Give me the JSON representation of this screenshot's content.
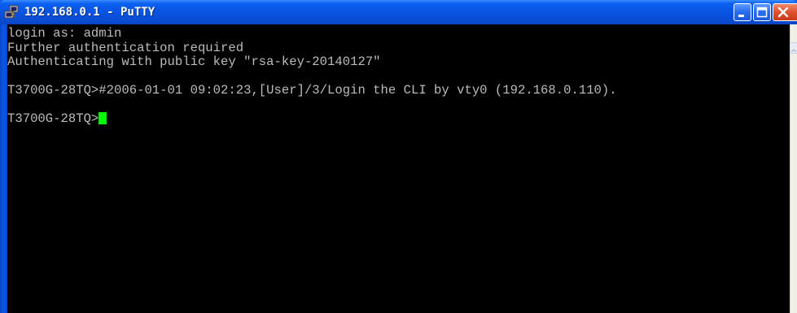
{
  "window": {
    "title": "192.168.0.1 - PuTTY",
    "icon": "putty-icon",
    "controls": [
      "minimize-icon",
      "maximize-icon",
      "close-icon"
    ]
  },
  "terminal": {
    "lines": [
      "login as: admin",
      "Further authentication required",
      "Authenticating with public key \"rsa-key-20140127\"",
      "",
      "T3700G-28TQ>#2006-01-01 09:02:23,[User]/3/Login the CLI by vty0 (192.168.0.110).",
      "",
      "T3700G-28TQ>"
    ],
    "cursor_color": "#00ff00",
    "text_color": "#bbbbbb",
    "background": "#000000"
  }
}
